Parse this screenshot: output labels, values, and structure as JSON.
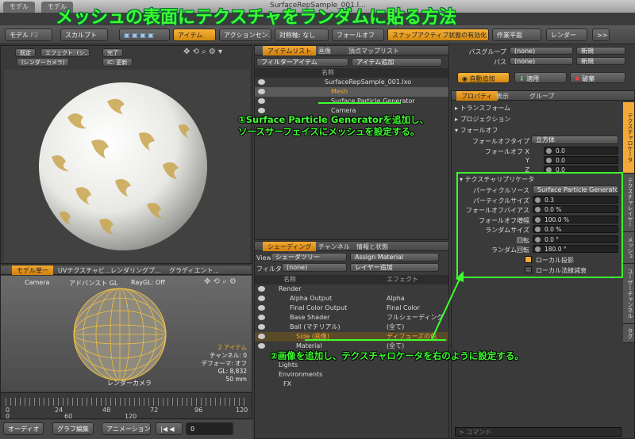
{
  "window": {
    "title": "SurfaceRepSample_001.l...",
    "tabs": [
      "モデル",
      "モデル"
    ]
  },
  "banner": "メッシュの表面にテクスチャをランダムに貼る方法",
  "toolbar": {
    "model": "モデル",
    "f2": "F2",
    "sculpt": "スカルプト",
    "item": "アイテム",
    "action_center": "アクションセン...",
    "symmetry": "対称軸: なし",
    "falloff": "フォールオフ",
    "snap": "スナップアクティブ状態の有効化",
    "work_plane": "作業平面",
    "render": "レンダー",
    "more": ">>"
  },
  "viewport1": {
    "buttons": [
      "既定",
      "エフェクト: (シ...",
      "完了",
      "(レンダーカメラ)",
      "IC: 更新"
    ]
  },
  "viewport2": {
    "tabs": [
      "モデル単一",
      "UVテクスチャビ...",
      "レンダリングプ...",
      "グラディエント..."
    ],
    "camera": "Camera",
    "shading": "アドバンスト GL",
    "raygl": "RayGL: Off",
    "cam_label": "レンダーカメラ",
    "stats": [
      "2 アイテム",
      "チャンネル: 0",
      "デフォーマ: オフ",
      "GL: 8,832",
      "50 mm"
    ]
  },
  "timeline": {
    "ticks": [
      "0",
      "24",
      "48",
      "72",
      "96",
      "120"
    ],
    "ticks2": [
      "0",
      "",
      "60",
      "",
      "120"
    ]
  },
  "bottombar": {
    "audio": "オーディオ",
    "graph": "グラフ編集",
    "animation": "アニメーション",
    "frame": "0"
  },
  "itemlist": {
    "tabs": [
      "アイテムリスト",
      "画像",
      "頂点マップリスト"
    ],
    "filter": "フィルターアイテム",
    "add": "アイテム追加",
    "col_name": "名称",
    "rows": [
      "SurfaceRepSample_001.lxo",
      "Mesh",
      "Surface Particle Generator",
      "Camera"
    ]
  },
  "shading": {
    "tabs": [
      "シェーディング",
      "チャンネル",
      "情報と状態"
    ],
    "view_label": "View",
    "view_val": "シェーダツリー",
    "assign": "Assign Material",
    "filter_label": "フィルター",
    "filter_val": "(none)",
    "add_layer": "レイヤー追加",
    "col_name": "名称",
    "col_effect": "エフェクト",
    "rows": [
      {
        "name": "Render",
        "effect": ""
      },
      {
        "name": "Alpha Output",
        "effect": "Alpha"
      },
      {
        "name": "Final Color Output",
        "effect": "Final Color"
      },
      {
        "name": "Base Shader",
        "effect": "フルシェーディング"
      },
      {
        "name": "Ball (マテリアル)",
        "effect": "(全て)"
      },
      {
        "name": "Side (画像)",
        "effect": "ディフューズの色"
      },
      {
        "name": "Material",
        "effect": "(全て)"
      },
      {
        "name": "Library",
        "effect": ""
      },
      {
        "name": "Lights",
        "effect": ""
      },
      {
        "name": "Environments",
        "effect": ""
      },
      {
        "name": "FX",
        "effect": ""
      }
    ]
  },
  "right_top": {
    "pass_group": "パスグループ",
    "pass": "パス",
    "none": "(none)",
    "new": "新規",
    "auto_add": "自動追加",
    "apply": "適用",
    "discard": "破棄"
  },
  "properties": {
    "tabs": [
      "プロパティ",
      "表示",
      "グループ"
    ],
    "sections": [
      "トランスフォーム",
      "プロジェクション",
      "フォールオフ"
    ],
    "falloff_type_label": "フォールオフタイプ",
    "falloff_type": "立方体",
    "falloff_x": "0.0",
    "falloff_y": "0.0",
    "falloff_z": "0.0",
    "locator_title": "テクスチャリプリケータ",
    "fields": [
      {
        "label": "パーティクルソース",
        "value": "Surface Particle Generator"
      },
      {
        "label": "パーティクルサイズ",
        "value": "0.3"
      },
      {
        "label": "フォールオフバイアス",
        "value": "0.0 %"
      },
      {
        "label": "フォールオフ増幅",
        "value": "100.0 %"
      },
      {
        "label": "ランダムサイズ",
        "value": "0.0 %"
      },
      {
        "label": "回転",
        "value": "0.0 °"
      },
      {
        "label": "ランダム回転",
        "value": "180.0 °"
      }
    ],
    "local_proj": "ローカル投影",
    "local_norm": "ローカル法線減衰",
    "vtabs": [
      "テクスチャロケータ",
      "テクスチャレイヤー",
      "メッシュ",
      "ユーザーチャンネル",
      "タグ"
    ],
    "command": "コマンド"
  },
  "annotations": {
    "a1": "①Surface Particle Generatorを追加し、",
    "a1b": "ソースサーフェイスにメッシュを設定する。",
    "a2": "②画像を追加し、テクスチャロケータを右のように設定する。"
  },
  "colors": {
    "accent": "#f3a935",
    "annot": "#3dff2f"
  }
}
